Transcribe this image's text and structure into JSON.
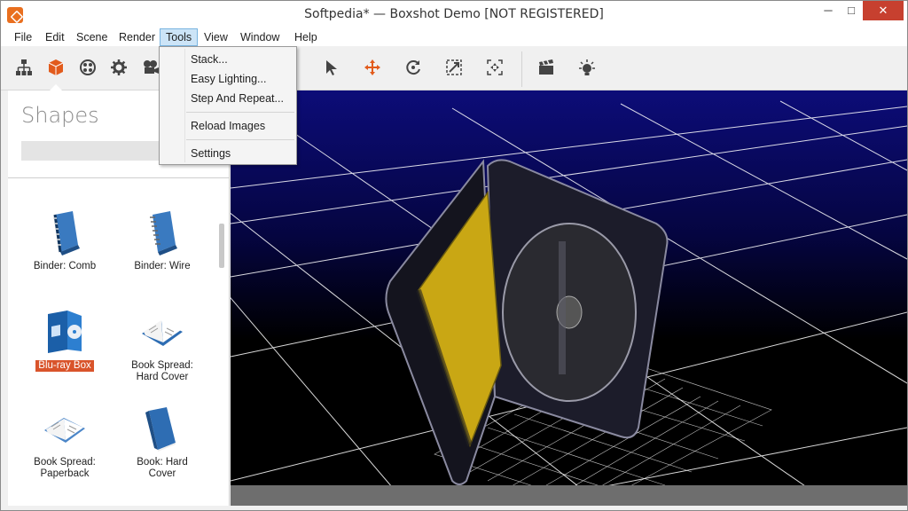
{
  "window": {
    "title": "Softpedia* — Boxshot Demo [NOT REGISTERED]",
    "min_glyph": "─",
    "max_glyph": "□",
    "close_glyph": "✕"
  },
  "menu": {
    "items": [
      "File",
      "Edit",
      "Scene",
      "Render",
      "Tools",
      "View",
      "Window",
      "Help"
    ],
    "active": "Tools"
  },
  "tools_menu": {
    "items": [
      "Stack...",
      "Easy Lighting...",
      "Step And Repeat...",
      "Reload Images",
      "Settings"
    ]
  },
  "toolbar": {
    "icons": [
      "hierarchy-icon",
      "shapes-cube-icon",
      "materials-icon",
      "settings-gear-icon",
      "camera-icon",
      "select-arrow-icon",
      "move-icon",
      "rotate-icon",
      "scale-icon",
      "fit-view-icon",
      "render-clapper-icon",
      "light-icon"
    ]
  },
  "left_panel": {
    "title": "Shapes",
    "search_value": "",
    "shapes": [
      {
        "label": "Binder: Comb",
        "icon": "binder-comb-icon",
        "selected": false
      },
      {
        "label": "Binder: Wire",
        "icon": "binder-wire-icon",
        "selected": false
      },
      {
        "label": "Blu-ray Box",
        "icon": "bluray-box-icon",
        "selected": true
      },
      {
        "label": "Book Spread:\nHard Cover",
        "icon": "book-spread-hard-icon",
        "selected": false
      },
      {
        "label": "Book Spread:\nPaperback",
        "icon": "book-spread-paperback-icon",
        "selected": false
      },
      {
        "label": "Book: Hard\nCover",
        "icon": "book-hard-cover-icon",
        "selected": false
      }
    ]
  },
  "colors": {
    "accent": "#d9542b",
    "viewport_sky": "#0a0a6e",
    "grid_line": "#ffffff",
    "case_plastic": "#1c1c2a",
    "case_insert": "#c9a714"
  }
}
